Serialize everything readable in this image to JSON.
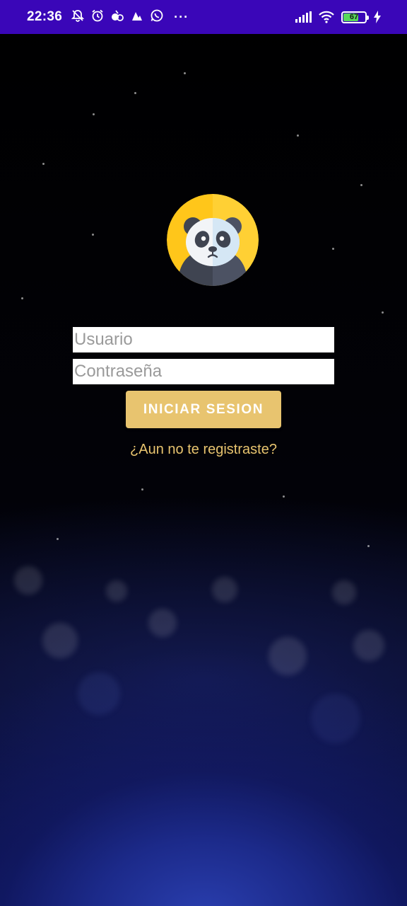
{
  "status_bar": {
    "time": "22:36",
    "more": "···",
    "battery_level": 67,
    "battery_level_label": "67",
    "bg_color": "#3a06b8",
    "icons_left": [
      "mute-bell-icon",
      "alarm-icon",
      "app-notification-icon",
      "app-notification-icon",
      "whatsapp-icon"
    ],
    "icons_right": [
      "signal-icon",
      "wifi-icon",
      "battery-icon",
      "charging-bolt-icon"
    ]
  },
  "login": {
    "logo": "panda-logo",
    "username_placeholder": "Usuario",
    "password_placeholder": "Contraseña",
    "login_button_label": "INICIAR SESION",
    "register_link": "¿Aun no te registraste?",
    "accent_color": "#e8c46f"
  }
}
